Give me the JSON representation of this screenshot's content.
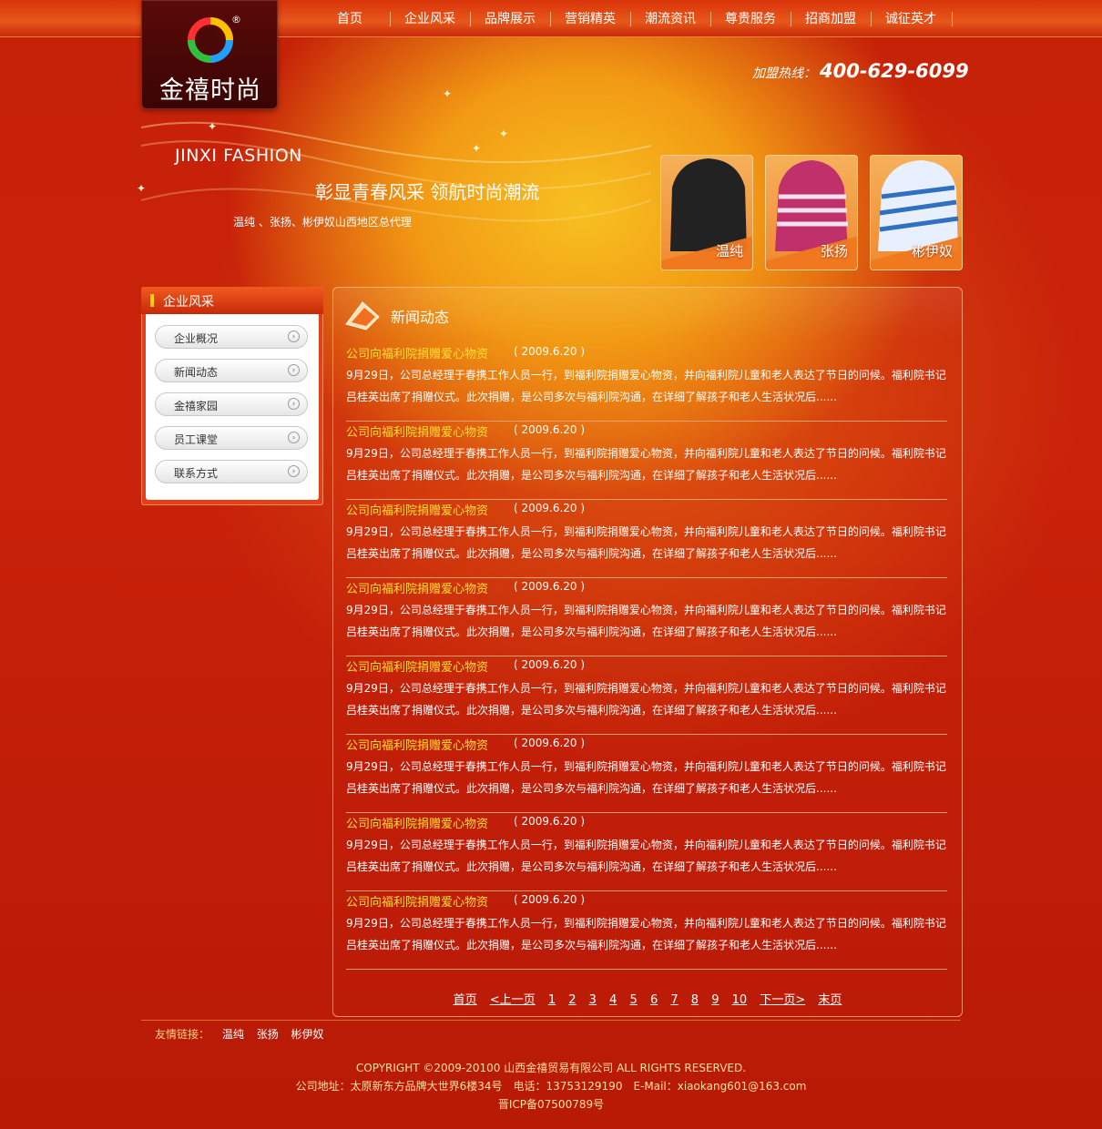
{
  "brand": {
    "logo_text": "金禧时尚",
    "reg_mark": "®"
  },
  "nav": [
    "首页",
    "企业风采",
    "品牌展示",
    "营销精英",
    "潮流资讯",
    "尊贵服务",
    "招商加盟",
    "诚征英才"
  ],
  "hotline": {
    "label": "加盟热线：",
    "number": "400-629-6099"
  },
  "banner": {
    "en_title": "JINXI FASHION",
    "slogan": "彰显青春风采 领航时尚潮流",
    "sub": "温纯 、张扬、彬伊奴山西地区总代理",
    "stars": [
      "温纯",
      "张扬",
      "彬伊奴"
    ]
  },
  "sidebar": {
    "title": "企业风采",
    "items": [
      "企业概况",
      "新闻动态",
      "金禧家园",
      "员工课堂",
      "联系方式"
    ]
  },
  "main": {
    "title": "新闻动态",
    "news": [
      {
        "title": "公司向福利院捐赠爱心物资",
        "date": "( 2009.6.20 )",
        "body": "9月29日，公司总经理于春携工作人员一行，到福利院捐赠爱心物资，并向福利院儿童和老人表达了节日的问候。福利院书记吕桂英出席了捐赠仪式。此次捐赠，是公司多次与福利院沟通，在详细了解孩子和老人生活状况后......"
      },
      {
        "title": "公司向福利院捐赠爱心物资",
        "date": "( 2009.6.20 )",
        "body": "9月29日，公司总经理于春携工作人员一行，到福利院捐赠爱心物资，并向福利院儿童和老人表达了节日的问候。福利院书记吕桂英出席了捐赠仪式。此次捐赠，是公司多次与福利院沟通，在详细了解孩子和老人生活状况后......"
      },
      {
        "title": "公司向福利院捐赠爱心物资",
        "date": "( 2009.6.20 )",
        "body": "9月29日，公司总经理于春携工作人员一行，到福利院捐赠爱心物资，并向福利院儿童和老人表达了节日的问候。福利院书记吕桂英出席了捐赠仪式。此次捐赠，是公司多次与福利院沟通，在详细了解孩子和老人生活状况后......"
      },
      {
        "title": "公司向福利院捐赠爱心物资",
        "date": "( 2009.6.20 )",
        "body": "9月29日，公司总经理于春携工作人员一行，到福利院捐赠爱心物资，并向福利院儿童和老人表达了节日的问候。福利院书记吕桂英出席了捐赠仪式。此次捐赠，是公司多次与福利院沟通，在详细了解孩子和老人生活状况后......"
      },
      {
        "title": "公司向福利院捐赠爱心物资",
        "date": "( 2009.6.20 )",
        "body": "9月29日，公司总经理于春携工作人员一行，到福利院捐赠爱心物资，并向福利院儿童和老人表达了节日的问候。福利院书记吕桂英出席了捐赠仪式。此次捐赠，是公司多次与福利院沟通，在详细了解孩子和老人生活状况后......"
      },
      {
        "title": "公司向福利院捐赠爱心物资",
        "date": "( 2009.6.20 )",
        "body": "9月29日，公司总经理于春携工作人员一行，到福利院捐赠爱心物资，并向福利院儿童和老人表达了节日的问候。福利院书记吕桂英出席了捐赠仪式。此次捐赠，是公司多次与福利院沟通，在详细了解孩子和老人生活状况后......"
      },
      {
        "title": "公司向福利院捐赠爱心物资",
        "date": "( 2009.6.20 )",
        "body": "9月29日，公司总经理于春携工作人员一行，到福利院捐赠爱心物资，并向福利院儿童和老人表达了节日的问候。福利院书记吕桂英出席了捐赠仪式。此次捐赠，是公司多次与福利院沟通，在详细了解孩子和老人生活状况后......"
      },
      {
        "title": "公司向福利院捐赠爱心物资",
        "date": "( 2009.6.20 )",
        "body": "9月29日，公司总经理于春携工作人员一行，到福利院捐赠爱心物资，并向福利院儿童和老人表达了节日的问候。福利院书记吕桂英出席了捐赠仪式。此次捐赠，是公司多次与福利院沟通，在详细了解孩子和老人生活状况后......"
      }
    ],
    "pager": [
      "首页",
      "<上一页",
      "1",
      "2",
      "3",
      "4",
      "5",
      "6",
      "7",
      "8",
      "9",
      "10",
      "下一页>",
      "末页"
    ]
  },
  "footer": {
    "links_label": "友情链接：",
    "links": [
      "温纯",
      "张扬",
      "彬伊奴"
    ],
    "copyright": "COPYRIGHT ©2009-20100 山西金禧贸易有限公司 ALL RIGHTS RESERVED.",
    "address": "公司地址：太原新东方品牌大世界6楼34号　电话：13753129190　E-Mail：xiaokang601@163.com",
    "icp": "晋ICP备07500789号"
  }
}
